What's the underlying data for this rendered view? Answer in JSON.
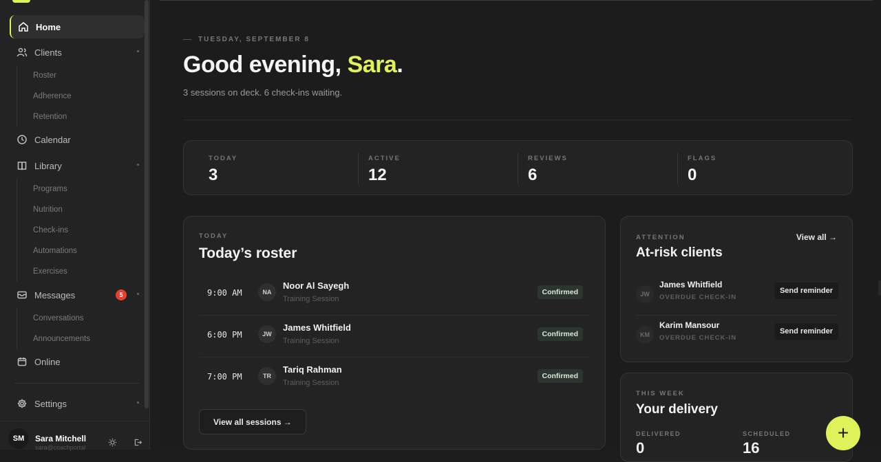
{
  "sidebar": {
    "items": [
      {
        "label": "Home"
      },
      {
        "label": "Clients",
        "children": [
          "Roster",
          "Adherence",
          "Retention"
        ]
      },
      {
        "label": "Calendar"
      },
      {
        "label": "Library",
        "children": [
          "Programs",
          "Nutrition",
          "Check-ins",
          "Automations",
          "Exercises"
        ]
      },
      {
        "label": "Messages",
        "badge": "5",
        "children": [
          "Conversations",
          "Announcements"
        ]
      },
      {
        "label": "Online"
      },
      {
        "label": "Settings"
      }
    ],
    "user": {
      "initials": "SM",
      "name": "Sara Mitchell",
      "email": "sara@coachportal"
    }
  },
  "header": {
    "date": "TUESDAY, SEPTEMBER 8",
    "greeting_prefix": "Good evening, ",
    "greeting_name": "Sara",
    "greeting_suffix": ".",
    "subline": "3 sessions on deck. 6 check-ins waiting."
  },
  "stats": [
    {
      "label": "TODAY",
      "value": "3"
    },
    {
      "label": "ACTIVE",
      "value": "12"
    },
    {
      "label": "REVIEWS",
      "value": "6"
    },
    {
      "label": "FLAGS",
      "value": "0"
    }
  ],
  "roster": {
    "eyebrow": "TODAY",
    "title": "Today’s roster",
    "rows": [
      {
        "time": "9:00 AM",
        "initials": "NA",
        "name": "Noor Al Sayegh",
        "type": "Training Session",
        "status": "Confirmed"
      },
      {
        "time": "6:00 PM",
        "initials": "JW",
        "name": "James Whitfield",
        "type": "Training Session",
        "status": "Confirmed"
      },
      {
        "time": "7:00 PM",
        "initials": "TR",
        "name": "Tariq Rahman",
        "type": "Training Session",
        "status": "Confirmed"
      }
    ],
    "view_all": "View all sessions →"
  },
  "atrisk": {
    "eyebrow": "ATTENTION",
    "title": "At-risk clients",
    "view_all": "View all →",
    "rows": [
      {
        "initials": "JW",
        "name": "James Whitfield",
        "reason": "OVERDUE CHECK-IN",
        "action": "Send reminder"
      },
      {
        "initials": "KM",
        "name": "Karim Mansour",
        "reason": "OVERDUE CHECK-IN",
        "action": "Send reminder"
      }
    ]
  },
  "delivery": {
    "eyebrow": "THIS WEEK",
    "title": "Your delivery",
    "delivered_label": "DELIVERED",
    "delivered_value": "0",
    "scheduled_label": "SCHEDULED",
    "scheduled_value": "16"
  },
  "fab": {
    "label": "+"
  },
  "colors": {
    "accent": "#dff25a",
    "badge": "#e5402f",
    "background": "#1c1c1c",
    "card": "#232323"
  }
}
